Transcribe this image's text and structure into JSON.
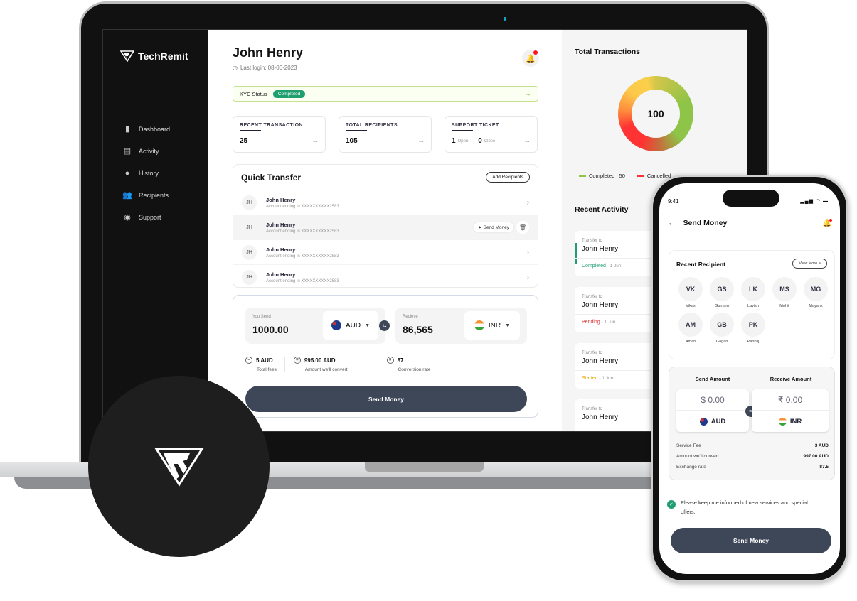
{
  "app": {
    "brand": "TechRemit"
  },
  "sidebar": {
    "items": [
      {
        "label": "Dashboard",
        "icon": "bar-chart-icon"
      },
      {
        "label": "Activity",
        "icon": "activity-icon"
      },
      {
        "label": "History",
        "icon": "clock-icon"
      },
      {
        "label": "Recipients",
        "icon": "users-icon"
      },
      {
        "label": "Support",
        "icon": "headset-icon"
      }
    ]
  },
  "header": {
    "user_name": "John Henry",
    "last_login": "Last login: 08-06-2023"
  },
  "kyc": {
    "label": "KYC Status",
    "status": "Completed"
  },
  "stats": {
    "recent_transaction": {
      "title": "RECENT TRANSACTION",
      "value": "25"
    },
    "total_recipients": {
      "title": "TOTAL RECIPIENTS",
      "value": "105"
    },
    "support_ticket": {
      "title": "SUPPORT TICKET",
      "open_value": "1",
      "open_label": "Open",
      "close_value": "0",
      "close_label": "Close"
    }
  },
  "quick_transfer": {
    "title": "Quick Transfer",
    "add_label": "Add Recipients",
    "send_label": "Send Money",
    "rows": [
      {
        "initials": "JH",
        "name": "John Henry",
        "account": "Account ending in XXXXXXXXXX2583"
      },
      {
        "initials": "JH",
        "name": "John Henry",
        "account": "Account ending in XXXXXXXXXX2583"
      },
      {
        "initials": "JH",
        "name": "John Henry",
        "account": "Account ending in XXXXXXXXXX2583"
      },
      {
        "initials": "JH",
        "name": "John Henry",
        "account": "Account ending in XXXXXXXXXX2583"
      }
    ]
  },
  "converter": {
    "send_label": "You Send",
    "send_amount": "1000.00",
    "send_currency": "AUD",
    "receive_label": "Recieve",
    "receive_amount": "86,565",
    "receive_currency": "INR",
    "fees": {
      "value": "5 AUD",
      "label": "Total fees"
    },
    "convert": {
      "value": "995.00 AUD",
      "label": "Amount we'll convert"
    },
    "rate": {
      "value": "87",
      "label": "Conversion rate"
    },
    "button": "Send Money"
  },
  "transactions": {
    "title": "Total Transactions",
    "total": "100",
    "legend": [
      {
        "label": "Completed : 50",
        "color": "#8ec448"
      },
      {
        "label": "Cancelled",
        "color": "#f33"
      }
    ]
  },
  "recent_activity": {
    "title": "Recent Activity",
    "items": [
      {
        "sub": "Transfer to",
        "name": "John Henry",
        "status": "Completed",
        "date": " - 1 Jun",
        "color": "#1f9e70"
      },
      {
        "sub": "Transfer to",
        "name": "John Henry",
        "status": "Pending",
        "date": " - 1 Jun",
        "color": "#d62b2b"
      },
      {
        "sub": "Transfer to",
        "name": "John Henry",
        "status": "Started",
        "date": " - 1 Jun",
        "color": "#e9a400"
      },
      {
        "sub": "Transfer to",
        "name": "John Henry",
        "status": "",
        "date": "",
        "color": "#999"
      }
    ]
  },
  "phone": {
    "time": "9:41",
    "status_icons": "▂▄▆ ◠ ▬",
    "title": "Send Money",
    "recent_title": "Recent Recipient",
    "view_more": "View More >",
    "recipients": [
      {
        "initials": "VK",
        "name": "Vikas"
      },
      {
        "initials": "GS",
        "name": "Gurnam"
      },
      {
        "initials": "LK",
        "name": "Lavish"
      },
      {
        "initials": "MS",
        "name": "Mohit"
      },
      {
        "initials": "MG",
        "name": "Mayank"
      },
      {
        "initials": "AM",
        "name": "Aman"
      },
      {
        "initials": "GB",
        "name": "Gagan"
      },
      {
        "initials": "PK",
        "name": "Pankaj"
      }
    ],
    "send_amount_label": "Send Amount",
    "receive_amount_label": "Receive Amount",
    "send_value": "$ 0.00",
    "receive_value": "₹ 0.00",
    "send_currency": "AUD",
    "receive_currency": "INR",
    "service_fee_label": "Service Fee",
    "service_fee": "3 AUD",
    "convert_label": "Amount we'll convert",
    "convert_value": "997.00 AUD",
    "rate_label": "Exchange rate",
    "rate_value": "87.5",
    "consent": "Please keep me informed of new services and special offers.",
    "button": "Send Money"
  }
}
